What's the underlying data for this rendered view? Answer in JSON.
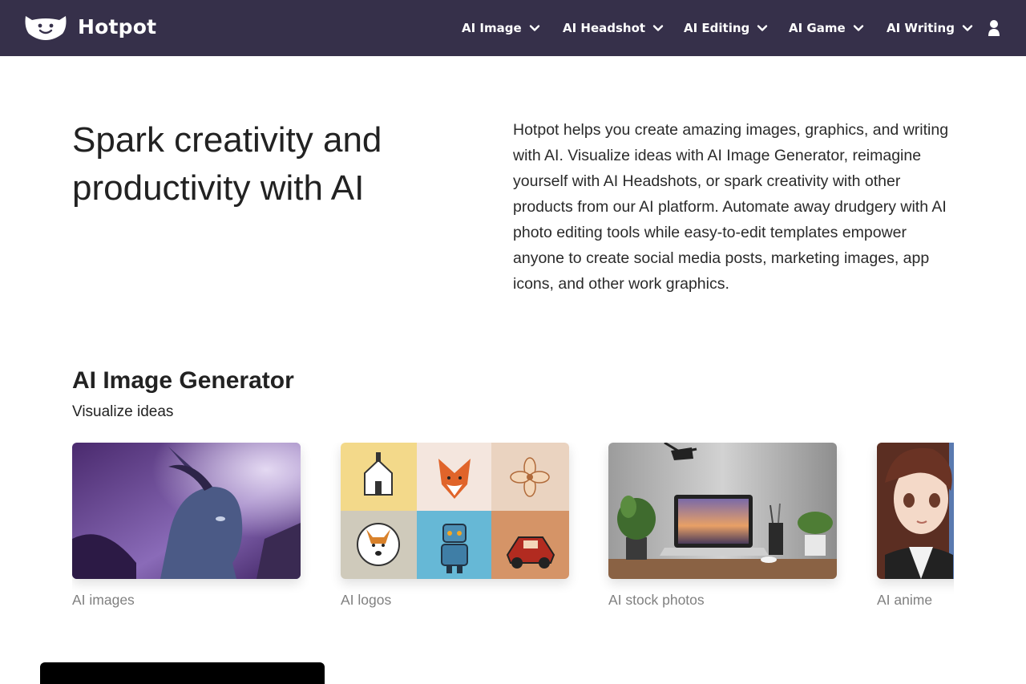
{
  "header": {
    "brand": "Hotpot",
    "nav": [
      {
        "label": "AI Image"
      },
      {
        "label": "AI Headshot"
      },
      {
        "label": "AI Editing"
      },
      {
        "label": "AI Game"
      },
      {
        "label": "AI Writing"
      }
    ],
    "icons": {
      "logo": "hotpot-face-logo",
      "account": "user-icon",
      "dropdown": "chevron-down-icon"
    }
  },
  "hero": {
    "title": "Spark creativity and productivity with AI",
    "body": "Hotpot helps you create amazing images, graphics, and writing with AI. Visualize ideas with AI Image Generator, reimagine yourself with AI Headshots, or spark creativity with other products from our AI platform. Automate away drudgery with AI photo editing tools while easy-to-edit templates empower anyone to create social media posts, marketing images, app icons, and other work graphics."
  },
  "section": {
    "title": "AI Image Generator",
    "subtitle": "Visualize ideas",
    "cards": [
      {
        "label": "AI images"
      },
      {
        "label": "AI logos"
      },
      {
        "label": "AI stock photos"
      },
      {
        "label": "AI anime"
      }
    ]
  },
  "colors": {
    "header_bg": "#36304a",
    "text": "#222222",
    "muted": "#808080"
  }
}
